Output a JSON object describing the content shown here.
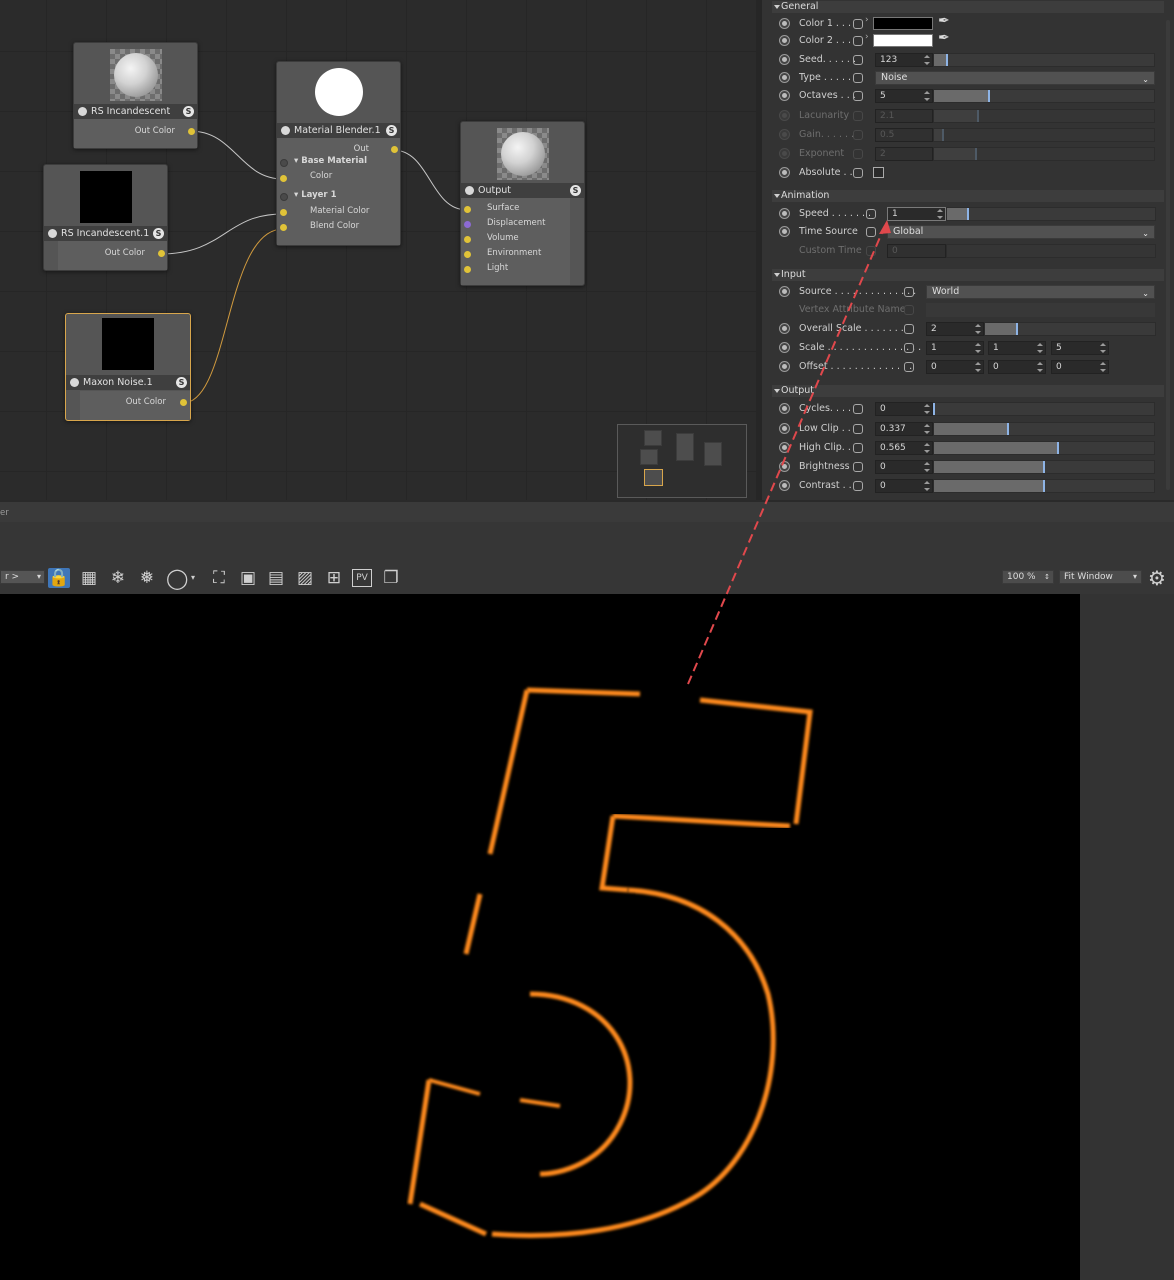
{
  "node_editor": {
    "nodes": {
      "rs_incandescent_a": {
        "title": "RS Incandescent",
        "out": "Out Color"
      },
      "rs_incandescent_b": {
        "title": "RS Incandescent.1",
        "out": "Out Color"
      },
      "maxon_noise": {
        "title": "Maxon Noise.1",
        "out": "Out Color"
      },
      "material_blender": {
        "title": "Material Blender.1",
        "out": "Out",
        "base_material": "Base Material",
        "color": "Color",
        "layer": "Layer 1",
        "material_color": "Material Color",
        "blend_color": "Blend Color"
      },
      "output": {
        "title": "Output",
        "ports": [
          "Surface",
          "Displacement",
          "Volume",
          "Environment",
          "Light"
        ]
      }
    },
    "badge": "S"
  },
  "attributes": {
    "sections": {
      "general": "General",
      "animation": "Animation",
      "input": "Input",
      "output": "Output"
    },
    "general": {
      "color1": {
        "label": "Color 1 . . .",
        "value": "#000000"
      },
      "color2": {
        "label": "Color 2 . . .",
        "value": "#ffffff"
      },
      "seed": {
        "label": "Seed. . . . . .",
        "value": "123",
        "fraction": 0.06
      },
      "type": {
        "label": "Type . . . . .",
        "value": "Noise"
      },
      "octaves": {
        "label": "Octaves . . .",
        "value": "5",
        "fraction": 0.25
      },
      "lacunarity": {
        "label": "Lacunarity",
        "value": "2.1",
        "fraction": 0.2
      },
      "gain": {
        "label": "Gain. . . . . .",
        "value": "0.5",
        "fraction": 0.04
      },
      "exponent": {
        "label": "Exponent",
        "value": "2",
        "fraction": 0.19
      },
      "absolute": {
        "label": "Absolute . ."
      }
    },
    "animation": {
      "speed": {
        "label": "Speed . . . . . . .",
        "value": "1",
        "fraction": 0.1
      },
      "time_source": {
        "label": "Time Source",
        "value": "Global"
      },
      "custom_time": {
        "label": "Custom Time",
        "value": "0"
      }
    },
    "input": {
      "source": {
        "label": "Source . . . . . . . . . . . . . .",
        "value": "World"
      },
      "vertex_attr": {
        "label": "Vertex Attribute Name"
      },
      "overall_scale": {
        "label": "Overall Scale . . . . . . .",
        "value": "2",
        "fraction": 0.19
      },
      "scale": {
        "label": "Scale . . . . . . . . . . . . . . . .",
        "x": "1",
        "y": "1",
        "z": "5"
      },
      "offset": {
        "label": "Offset . . . . . . . . . . . . . .",
        "x": "0",
        "y": "0",
        "z": "0"
      }
    },
    "output": {
      "cycles": {
        "label": "Cycles. . . .",
        "value": "0",
        "fraction": 0.0
      },
      "low_clip": {
        "label": "Low Clip . .",
        "value": "0.337",
        "fraction": 0.337
      },
      "high_clip": {
        "label": "High Clip. .",
        "value": "0.565",
        "fraction": 0.565
      },
      "brightness": {
        "label": "Brightness",
        "value": "0",
        "fraction": 0.5
      },
      "contrast": {
        "label": "Contrast . .",
        "value": "0",
        "fraction": 0.5
      }
    }
  },
  "viewer": {
    "header_text": "er",
    "layer_select": "r >",
    "zoom": "100 %",
    "fit": "Fit Window"
  },
  "render": {
    "digit": "5",
    "glow_color": "#ff8a1a",
    "annotation_color": "#e0484c"
  },
  "icons": [
    "lock-icon",
    "grid-icon",
    "snowflake-icon",
    "snowflake-region-icon",
    "circle-icon",
    "focus-icon",
    "region-icon",
    "wand-icon",
    "image-icon",
    "add-icon",
    "pv-icon",
    "copy-icon",
    "gear-icon",
    "eyedropper-icon"
  ]
}
